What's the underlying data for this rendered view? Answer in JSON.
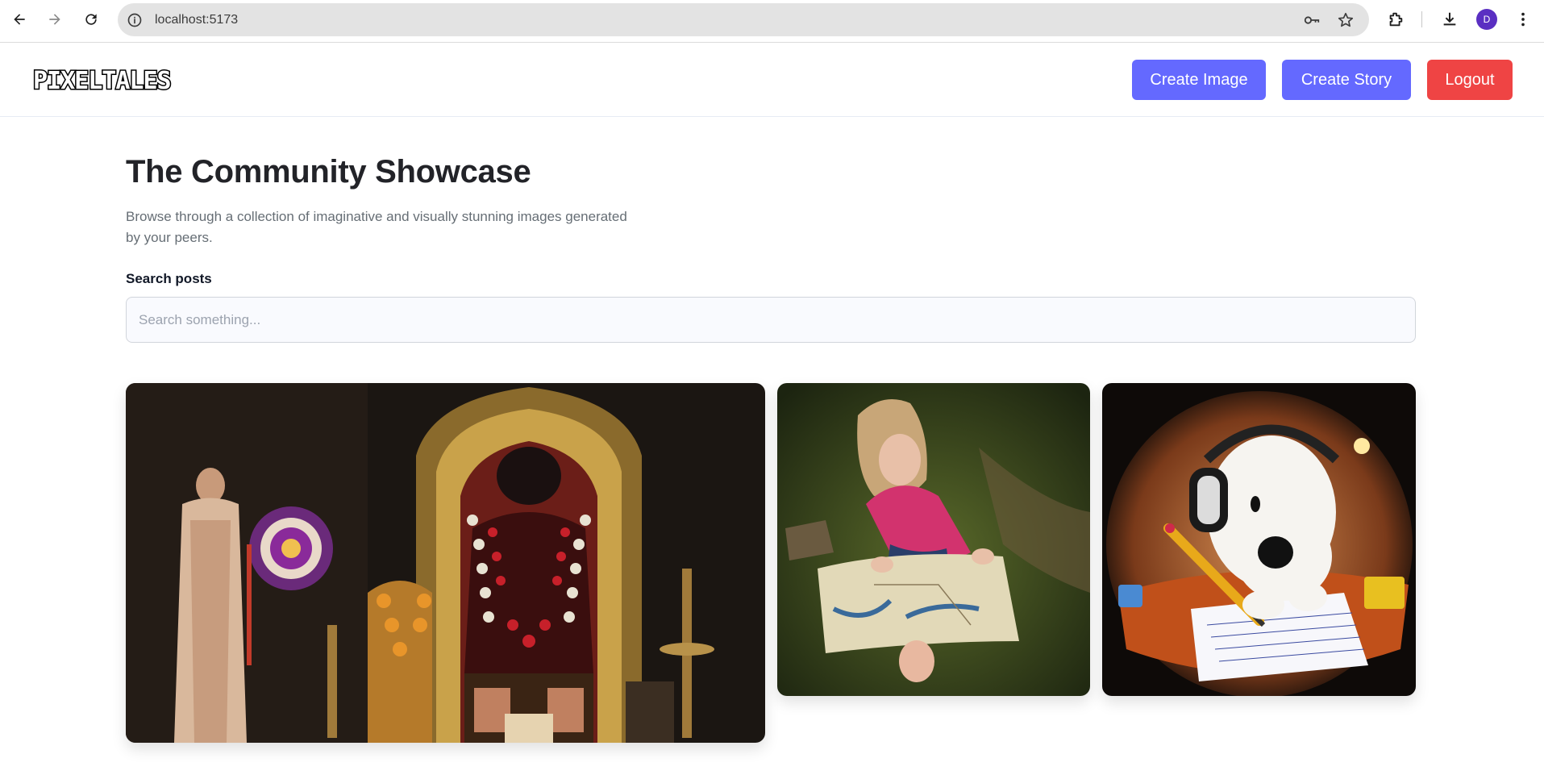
{
  "browser": {
    "url": "localhost:5173",
    "profile_initial": "D",
    "icons": [
      "back-icon",
      "forward-icon",
      "reload-icon",
      "site-info-icon",
      "password-key-icon",
      "bookmark-star-icon",
      "extensions-icon",
      "download-icon",
      "menu-dots-icon"
    ]
  },
  "header": {
    "logo_text": "PIXELTALES",
    "create_image_label": "Create Image",
    "create_story_label": "Create Story",
    "logout_label": "Logout"
  },
  "main": {
    "title": "The Community Showcase",
    "subtitle": "Browse through a collection of imaginative and visually stunning images generated by your peers.",
    "search": {
      "label": "Search posts",
      "placeholder": "Search something...",
      "value": ""
    },
    "posts": [
      {
        "image": "temple-deity-image"
      },
      {
        "image": "girl-with-map-image"
      },
      {
        "image": "snoopy-headphones-image"
      }
    ]
  },
  "colors": {
    "primary": "#6469ff",
    "danger": "#ef4444",
    "title": "#222328",
    "subtitle": "#666e75"
  }
}
